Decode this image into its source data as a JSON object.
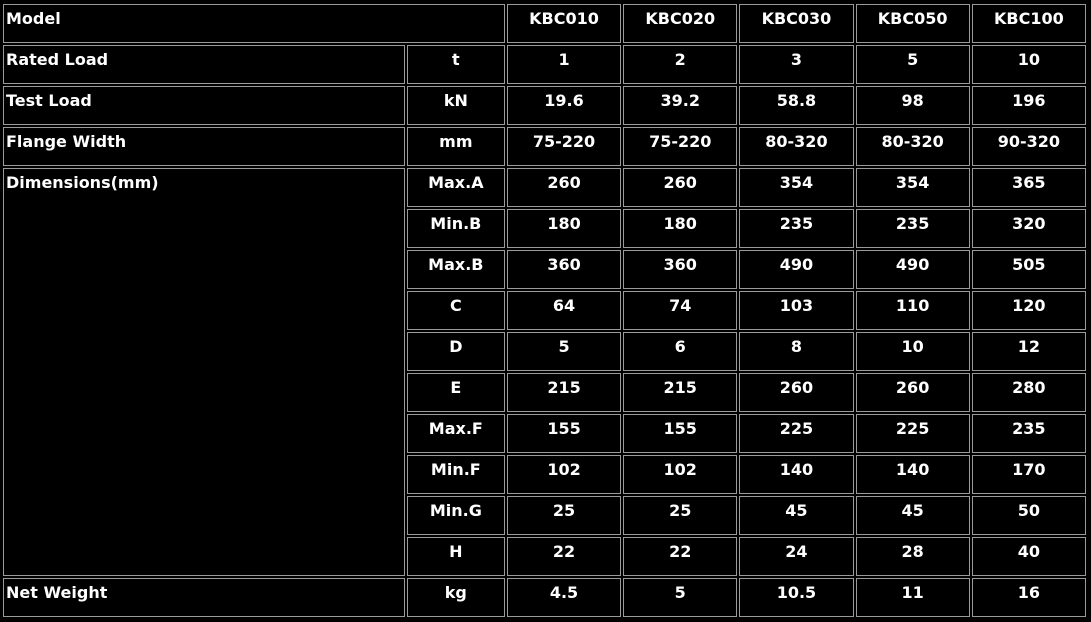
{
  "header": {
    "model_label": "Model",
    "models": [
      "KBC010",
      "KBC020",
      "KBC030",
      "KBC050",
      "KBC100"
    ]
  },
  "rows": {
    "rated_load": {
      "label": "Rated Load",
      "unit": "t",
      "values": [
        "1",
        "2",
        "3",
        "5",
        "10"
      ]
    },
    "test_load": {
      "label": "Test Load",
      "unit": "kN",
      "values": [
        "19.6",
        "39.2",
        "58.8",
        "98",
        "196"
      ]
    },
    "flange_width": {
      "label": "Flange Width",
      "unit": "mm",
      "values": [
        "75-220",
        "75-220",
        "80-320",
        "80-320",
        "90-320"
      ]
    },
    "net_weight": {
      "label": "Net Weight",
      "unit": "kg",
      "values": [
        "4.5",
        "5",
        "10.5",
        "11",
        "16"
      ]
    }
  },
  "dimensions": {
    "label": "Dimensions(mm)",
    "rows": [
      {
        "name": "Max.A",
        "values": [
          "260",
          "260",
          "354",
          "354",
          "365"
        ]
      },
      {
        "name": "Min.B",
        "values": [
          "180",
          "180",
          "235",
          "235",
          "320"
        ]
      },
      {
        "name": "Max.B",
        "values": [
          "360",
          "360",
          "490",
          "490",
          "505"
        ]
      },
      {
        "name": "C",
        "values": [
          "64",
          "74",
          "103",
          "110",
          "120"
        ]
      },
      {
        "name": "D",
        "values": [
          "5",
          "6",
          "8",
          "10",
          "12"
        ]
      },
      {
        "name": "E",
        "values": [
          "215",
          "215",
          "260",
          "260",
          "280"
        ]
      },
      {
        "name": "Max.F",
        "values": [
          "155",
          "155",
          "225",
          "225",
          "235"
        ]
      },
      {
        "name": "Min.F",
        "values": [
          "102",
          "102",
          "140",
          "140",
          "170"
        ]
      },
      {
        "name": "Min.G",
        "values": [
          "25",
          "25",
          "45",
          "45",
          "50"
        ]
      },
      {
        "name": "H",
        "values": [
          "22",
          "22",
          "24",
          "28",
          "40"
        ]
      }
    ]
  },
  "colors": {
    "background": "#000000",
    "border": "#9a9a9a",
    "text": "#ffffff"
  }
}
